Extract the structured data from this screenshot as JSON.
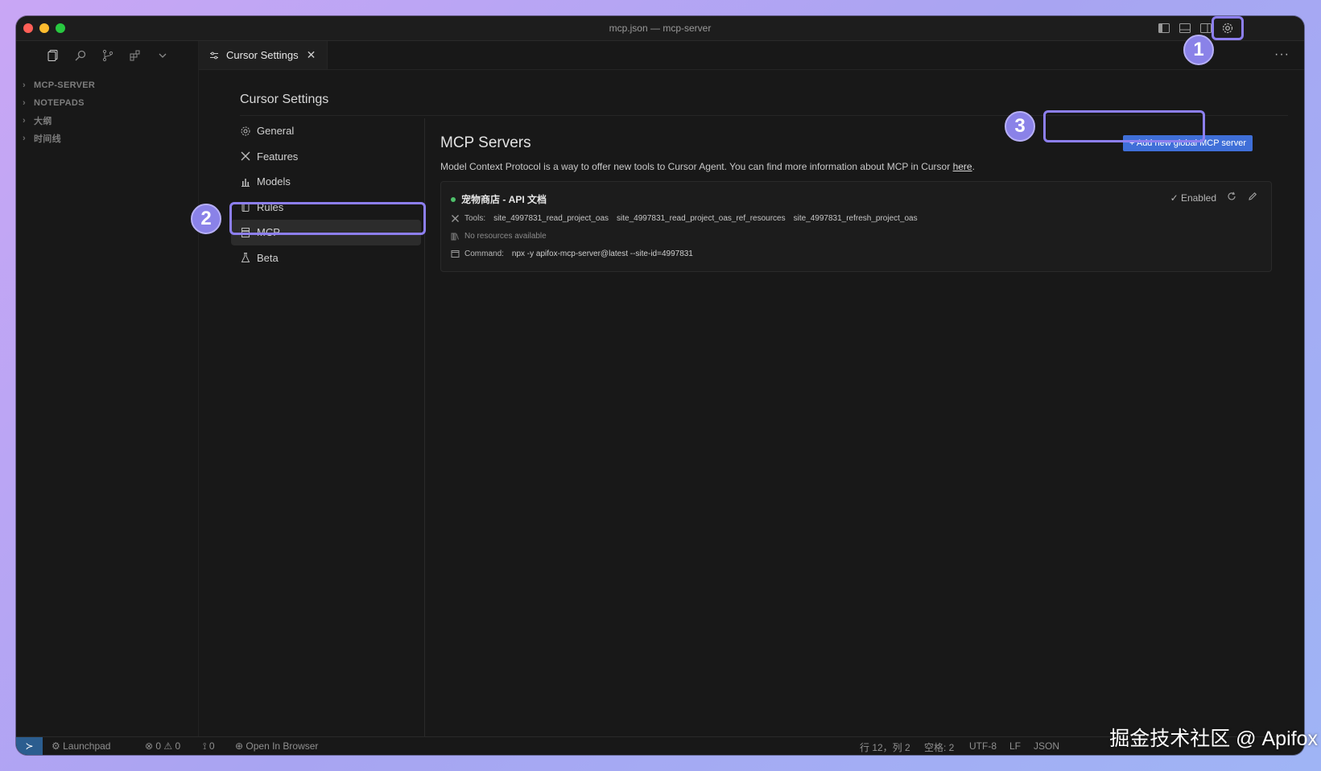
{
  "window": {
    "title": "mcp.json — mcp-server"
  },
  "explorer": {
    "items": [
      {
        "label": "MCP-SERVER"
      },
      {
        "label": "NOTEPADS"
      },
      {
        "label": "大纲"
      },
      {
        "label": "时间线"
      }
    ]
  },
  "tab": {
    "label": "Cursor Settings",
    "more": "···"
  },
  "settings": {
    "title": "Cursor Settings",
    "nav": [
      {
        "label": "General",
        "icon": "gear-icon"
      },
      {
        "label": "Features",
        "icon": "tools-icon"
      },
      {
        "label": "Models",
        "icon": "chart-icon"
      },
      {
        "label": "Rules",
        "icon": "book-icon"
      },
      {
        "label": "MCP",
        "icon": "server-icon",
        "active": true
      },
      {
        "label": "Beta",
        "icon": "flask-icon"
      }
    ]
  },
  "mcp": {
    "title": "MCP Servers",
    "description": "Model Context Protocol is a way to offer new tools to Cursor Agent. You can find more information about MCP in Cursor",
    "link_text": "here",
    "add_button": "+ Add new global MCP server",
    "server": {
      "name": "宠物商店 - API 文档",
      "status": "✓ Enabled",
      "tools_label": "Tools:",
      "tools": [
        "site_4997831_read_project_oas",
        "site_4997831_read_project_oas_ref_resources",
        "site_4997831_refresh_project_oas"
      ],
      "resources": "No resources available",
      "command_label": "Command:",
      "command": "npx -y apifox-mcp-server@latest --site-id=4997831"
    }
  },
  "annotations": {
    "badge1": "1",
    "badge2": "2",
    "badge3": "3"
  },
  "statusbar": {
    "launchpad": "Launchpad",
    "errors": "⊗ 0 ⚠ 0",
    "ports": "0",
    "open_browser": "Open In Browser",
    "position": "行 12，列 2",
    "spaces": "空格: 2",
    "encoding": "UTF-8",
    "eol": "LF",
    "language": "JSON"
  },
  "watermark": "掘金技术社区 @ Apifox",
  "colors": {
    "accent": "#3f6fd8",
    "highlight": "#8d7ff0",
    "status_green": "#4ec06a"
  }
}
